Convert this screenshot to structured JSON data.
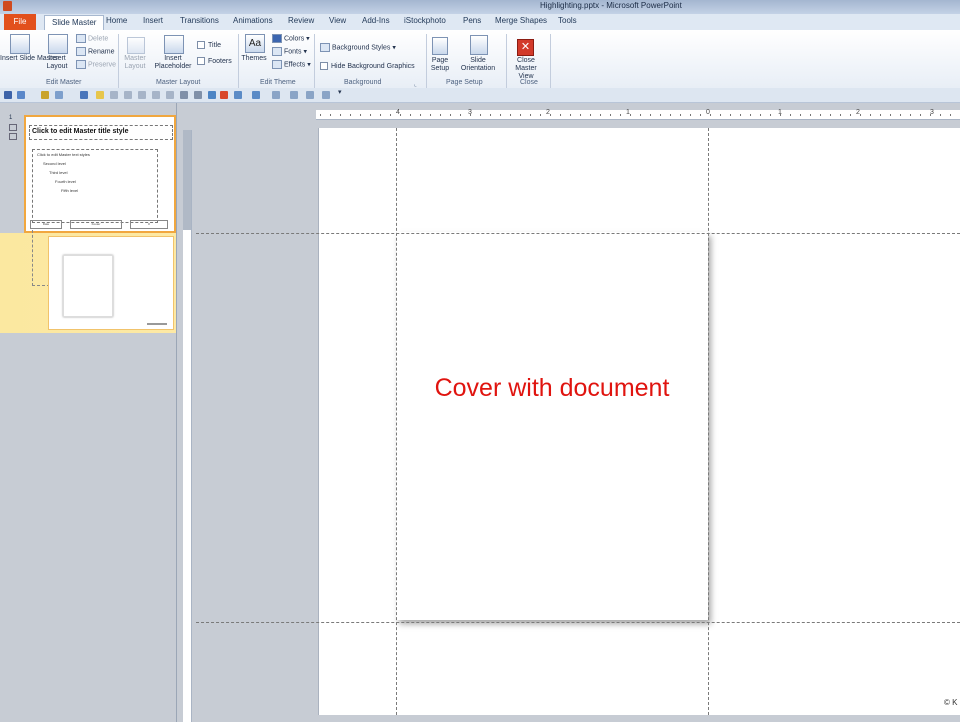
{
  "window": {
    "title": "Highlighting.pptx - Microsoft PowerPoint"
  },
  "tabs": [
    {
      "label": "File"
    },
    {
      "label": "Slide Master"
    },
    {
      "label": "Home"
    },
    {
      "label": "Insert"
    },
    {
      "label": "Transitions"
    },
    {
      "label": "Animations"
    },
    {
      "label": "Review"
    },
    {
      "label": "View"
    },
    {
      "label": "Add-Ins"
    },
    {
      "label": "iStockphoto"
    },
    {
      "label": "Pens"
    },
    {
      "label": "Merge Shapes"
    },
    {
      "label": "Tools"
    }
  ],
  "ribbon": {
    "edit_master": {
      "insert_slide_master": "Insert Slide Master",
      "insert_layout": "Insert Layout",
      "delete": "Delete",
      "rename": "Rename",
      "preserve": "Preserve",
      "group": "Edit Master"
    },
    "master_layout": {
      "master_layout": "Master Layout",
      "insert_placeholder": "Insert Placeholder",
      "title": "Title",
      "footers": "Footers",
      "group": "Master Layout"
    },
    "edit_theme": {
      "themes": "Themes",
      "colors": "Colors",
      "fonts": "Fonts",
      "effects": "Effects",
      "group": "Edit Theme"
    },
    "background": {
      "background_styles": "Background Styles",
      "hide_background_graphics": "Hide Background Graphics",
      "group": "Background"
    },
    "page_setup": {
      "page_setup": "Page Setup",
      "slide_orientation": "Slide Orientation",
      "group": "Page Setup"
    },
    "close": {
      "close_master_view": "Close Master View",
      "group": "Close"
    }
  },
  "ruler": {
    "horizontal_labels": [
      "4",
      "3",
      "2",
      "1",
      "0",
      "1",
      "2",
      "3"
    ]
  },
  "thumbnails": {
    "first_number": "1",
    "master_title": "Click to edit Master title style",
    "levels": [
      "Click to edit Master text styles",
      "Second level",
      "Third level",
      "Fourth level",
      "Fifth level"
    ],
    "footer_left": "Date",
    "footer_mid": "Footer",
    "footer_right": "#"
  },
  "slide": {
    "text": "Cover with document",
    "copyright": "© K"
  },
  "colors": {
    "file_tab": "#e2501c",
    "slide_text": "#e0140f",
    "selection": "#f1a73f"
  }
}
